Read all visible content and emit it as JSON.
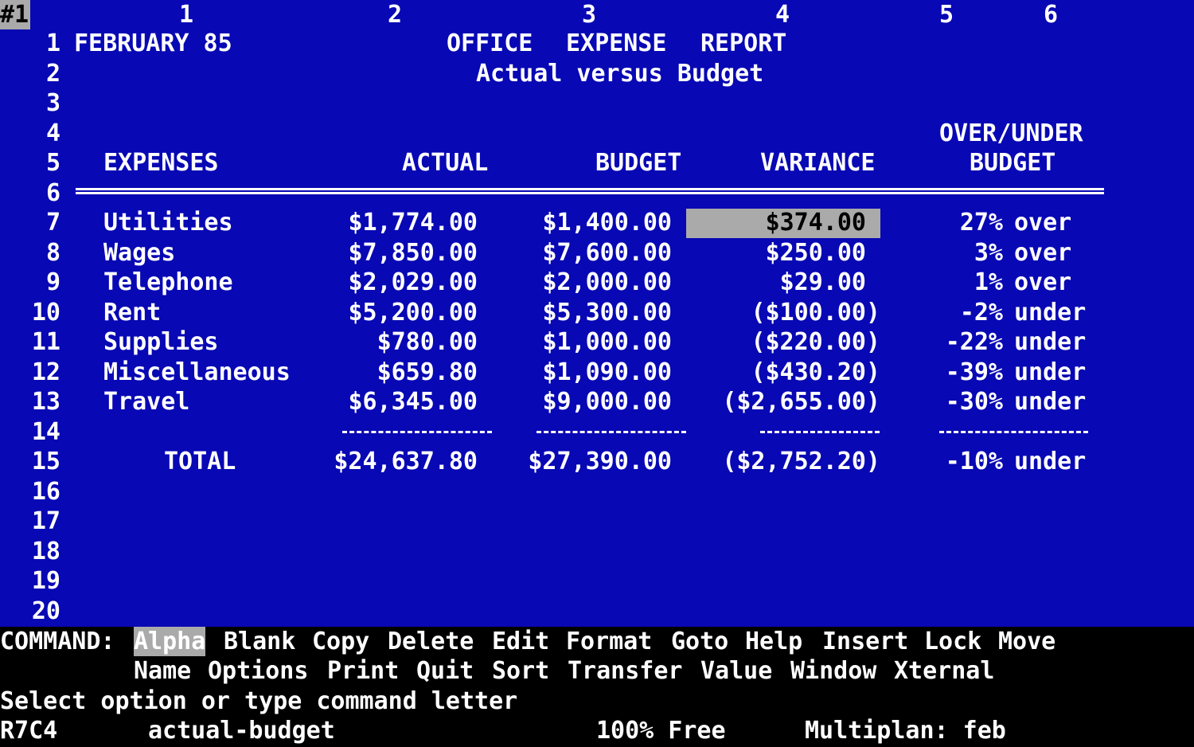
{
  "window_indicator": "#1",
  "column_headers": [
    "1",
    "2",
    "3",
    "4",
    "5",
    "6"
  ],
  "row_numbers": [
    "1",
    "2",
    "3",
    "4",
    "5",
    "6",
    "7",
    "8",
    "9",
    "10",
    "11",
    "12",
    "13",
    "14",
    "15",
    "16",
    "17",
    "18",
    "19",
    "20"
  ],
  "report": {
    "date": "FEBRUARY 85",
    "title_1": "OFFICE",
    "title_2": "EXPENSE",
    "title_3": "REPORT",
    "subtitle": "Actual versus Budget",
    "over_under_header_1": "OVER/UNDER",
    "over_under_header_2": "BUDGET"
  },
  "table_headers": {
    "expenses": "EXPENSES",
    "actual": "ACTUAL",
    "budget": "BUDGET",
    "variance": "VARIANCE"
  },
  "rows": [
    {
      "expense": "Utilities",
      "actual": "$1,774.00",
      "budget": "$1,400.00",
      "variance": "$374.00",
      "pct": "27%",
      "dir": "over"
    },
    {
      "expense": "Wages",
      "actual": "$7,850.00",
      "budget": "$7,600.00",
      "variance": "$250.00",
      "pct": "3%",
      "dir": "over"
    },
    {
      "expense": "Telephone",
      "actual": "$2,029.00",
      "budget": "$2,000.00",
      "variance": "$29.00",
      "pct": "1%",
      "dir": "over"
    },
    {
      "expense": "Rent",
      "actual": "$5,200.00",
      "budget": "$5,300.00",
      "variance": "($100.00)",
      "pct": "-2%",
      "dir": "under"
    },
    {
      "expense": "Supplies",
      "actual": "$780.00",
      "budget": "$1,000.00",
      "variance": "($220.00)",
      "pct": "-22%",
      "dir": "under"
    },
    {
      "expense": "Miscellaneous",
      "actual": "$659.80",
      "budget": "$1,090.00",
      "variance": "($430.20)",
      "pct": "-39%",
      "dir": "under"
    },
    {
      "expense": "Travel",
      "actual": "$6,345.00",
      "budget": "$9,000.00",
      "variance": "($2,655.00)",
      "pct": "-30%",
      "dir": "under"
    }
  ],
  "total": {
    "label": "TOTAL",
    "actual": "$24,637.80",
    "budget": "$27,390.00",
    "variance": "($2,752.20)",
    "pct": "-10%",
    "dir": "under"
  },
  "command": {
    "label": "COMMAND:",
    "selected": "Alpha",
    "line1": [
      "Blank",
      "Copy",
      "Delete",
      "Edit",
      "Format",
      "Goto",
      "Help",
      "Insert",
      "Lock",
      "Move"
    ],
    "line2": [
      "Name",
      "Options",
      "Print",
      "Quit",
      "Sort",
      "Transfer",
      "Value",
      "Window",
      "Xternal"
    ]
  },
  "message": "Select option or type command letter",
  "status": {
    "cell": "R7C4",
    "content": "actual-budget",
    "free": "100% Free",
    "file": "Multiplan: feb"
  },
  "colors": {
    "sheet_bg": "#0808b4",
    "text": "#ffffff",
    "highlight": "#aaaaaa",
    "command_bg": "#000000"
  }
}
